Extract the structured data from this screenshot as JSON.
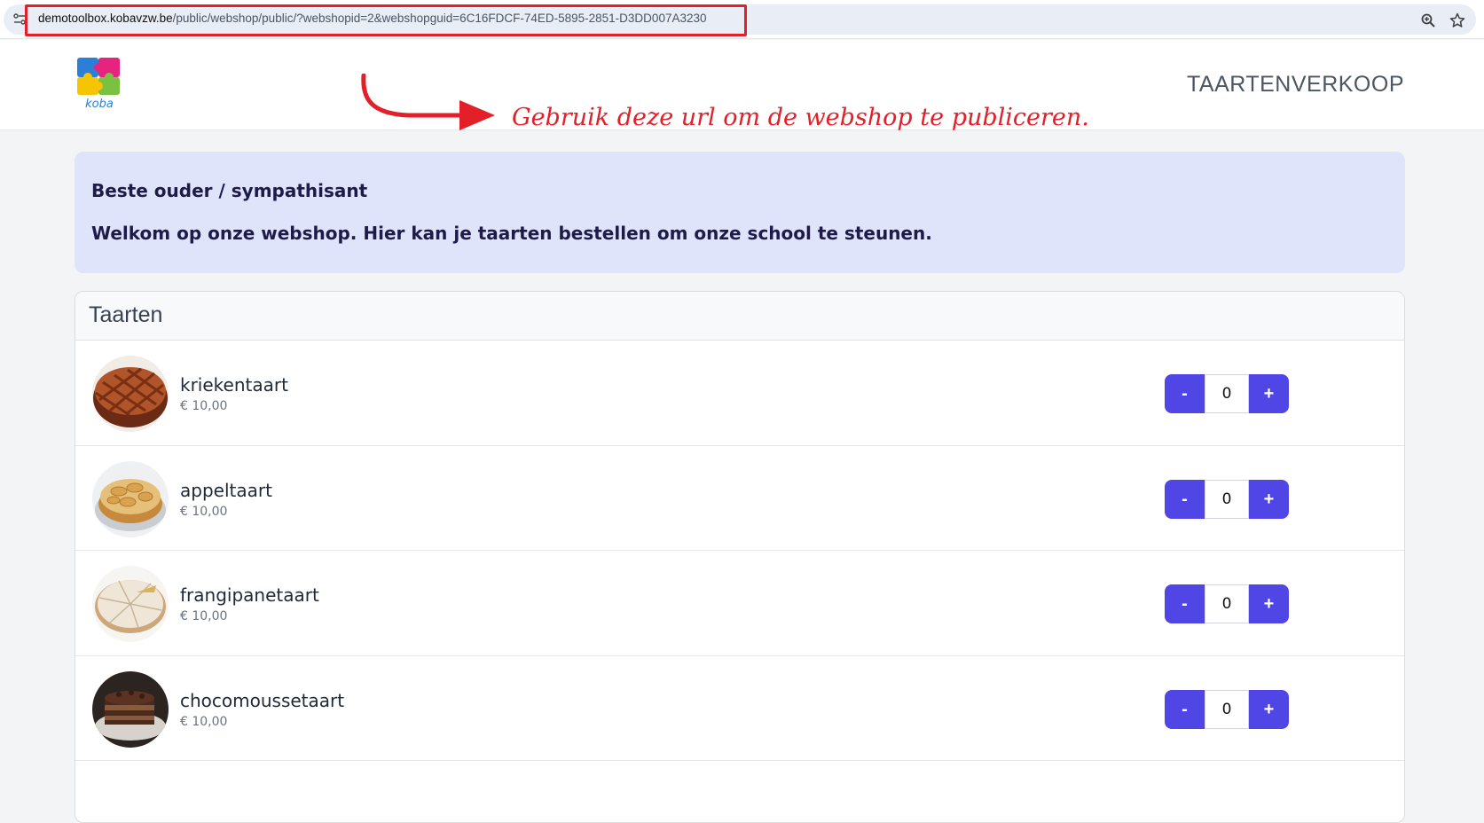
{
  "browser": {
    "url_host": "demotoolbox.kobavzw.be",
    "url_path": "/public/webshop/public/?webshopid=2&webshopguid=6C16FDCF-74ED-5895-2851-D3DD007A3230"
  },
  "annotation": {
    "text": "Gebruik deze url om de webshop te publiceren."
  },
  "header": {
    "logo_text": "koba",
    "site_title": "TAARTENVERKOOP"
  },
  "welcome": {
    "greeting": "Beste ouder / sympathisant",
    "intro": "Welkom op onze webshop. Hier kan je taarten bestellen om onze school te steunen."
  },
  "catalog": {
    "title": "Taarten",
    "products": [
      {
        "name": "kriekentaart",
        "price": "€ 10,00",
        "quantity": "0",
        "minus": "-",
        "plus": "+"
      },
      {
        "name": "appeltaart",
        "price": "€ 10,00",
        "quantity": "0",
        "minus": "-",
        "plus": "+"
      },
      {
        "name": "frangipanetaart",
        "price": "€ 10,00",
        "quantity": "0",
        "minus": "-",
        "plus": "+"
      },
      {
        "name": "chocomoussetaart",
        "price": "€ 10,00",
        "quantity": "0",
        "minus": "-",
        "plus": "+"
      }
    ]
  },
  "colors": {
    "accent": "#4f46e5",
    "annotation": "#e3202a",
    "welcome_bg": "#e0e4fb"
  }
}
